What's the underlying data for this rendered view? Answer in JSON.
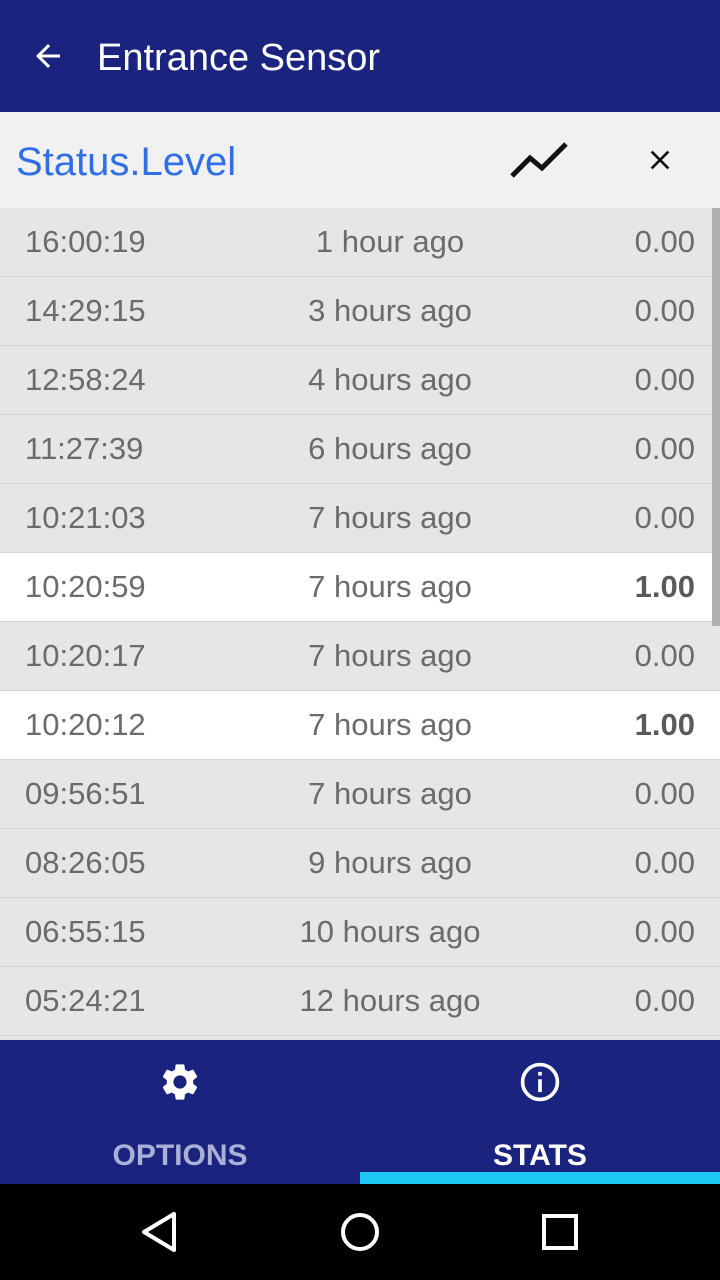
{
  "appbar": {
    "title": "Entrance Sensor",
    "back_icon": "arrow-back-icon"
  },
  "subheader": {
    "title": "Status.Level",
    "chart_icon": "line-chart-icon",
    "close_icon": "close-icon"
  },
  "rows": [
    {
      "time": "16:00:19",
      "ago": "1 hour ago",
      "value": "0.00",
      "active": false
    },
    {
      "time": "14:29:15",
      "ago": "3 hours ago",
      "value": "0.00",
      "active": false
    },
    {
      "time": "12:58:24",
      "ago": "4 hours ago",
      "value": "0.00",
      "active": false
    },
    {
      "time": "11:27:39",
      "ago": "6 hours ago",
      "value": "0.00",
      "active": false
    },
    {
      "time": "10:21:03",
      "ago": "7 hours ago",
      "value": "0.00",
      "active": false
    },
    {
      "time": "10:20:59",
      "ago": "7 hours ago",
      "value": "1.00",
      "active": true
    },
    {
      "time": "10:20:17",
      "ago": "7 hours ago",
      "value": "0.00",
      "active": false
    },
    {
      "time": "10:20:12",
      "ago": "7 hours ago",
      "value": "1.00",
      "active": true
    },
    {
      "time": "09:56:51",
      "ago": "7 hours ago",
      "value": "0.00",
      "active": false
    },
    {
      "time": "08:26:05",
      "ago": "9 hours ago",
      "value": "0.00",
      "active": false
    },
    {
      "time": "06:55:15",
      "ago": "10 hours ago",
      "value": "0.00",
      "active": false
    },
    {
      "time": "05:24:21",
      "ago": "12 hours ago",
      "value": "0.00",
      "active": false
    }
  ],
  "bottom_nav": {
    "options_label": "OPTIONS",
    "options_icon": "gear-icon",
    "stats_label": "STATS",
    "stats_icon": "info-icon",
    "selected": "STATS"
  },
  "system_nav": {
    "back_icon": "triangle-back-icon",
    "home_icon": "circle-home-icon",
    "recents_icon": "square-recents-icon"
  },
  "colors": {
    "primary": "#1a237e",
    "accent": "#1ec8f5",
    "subtitle": "#2f6ee6"
  }
}
